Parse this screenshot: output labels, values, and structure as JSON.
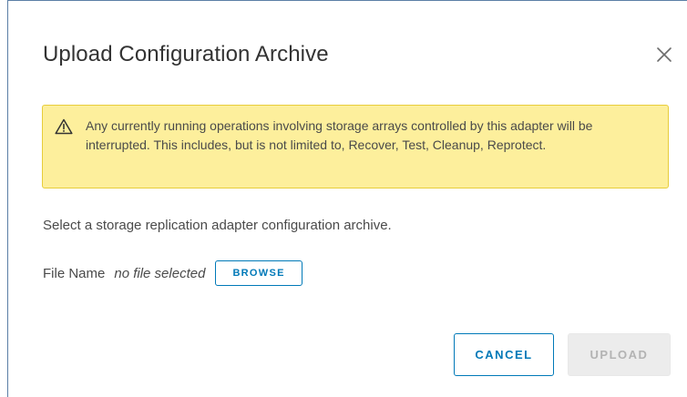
{
  "dialog": {
    "title": "Upload Configuration Archive",
    "close_icon": "close-icon"
  },
  "alert": {
    "icon": "warning-icon",
    "message": "Any currently running operations involving storage arrays controlled by this adapter will be interrupted. This includes, but is not limited to, Recover, Test, Cleanup, Reprotect.",
    "background_color": "#fdef9c",
    "border_color": "#e7cd3b"
  },
  "instruction": "Select a storage replication adapter configuration archive.",
  "file": {
    "label": "File Name",
    "value": "no file selected",
    "browse_label": "BROWSE"
  },
  "footer": {
    "cancel_label": "CANCEL",
    "upload_label": "UPLOAD",
    "upload_disabled": true
  },
  "colors": {
    "accent": "#0079b8",
    "disabled_bg": "#ececec",
    "disabled_text": "#b3b3b3"
  }
}
